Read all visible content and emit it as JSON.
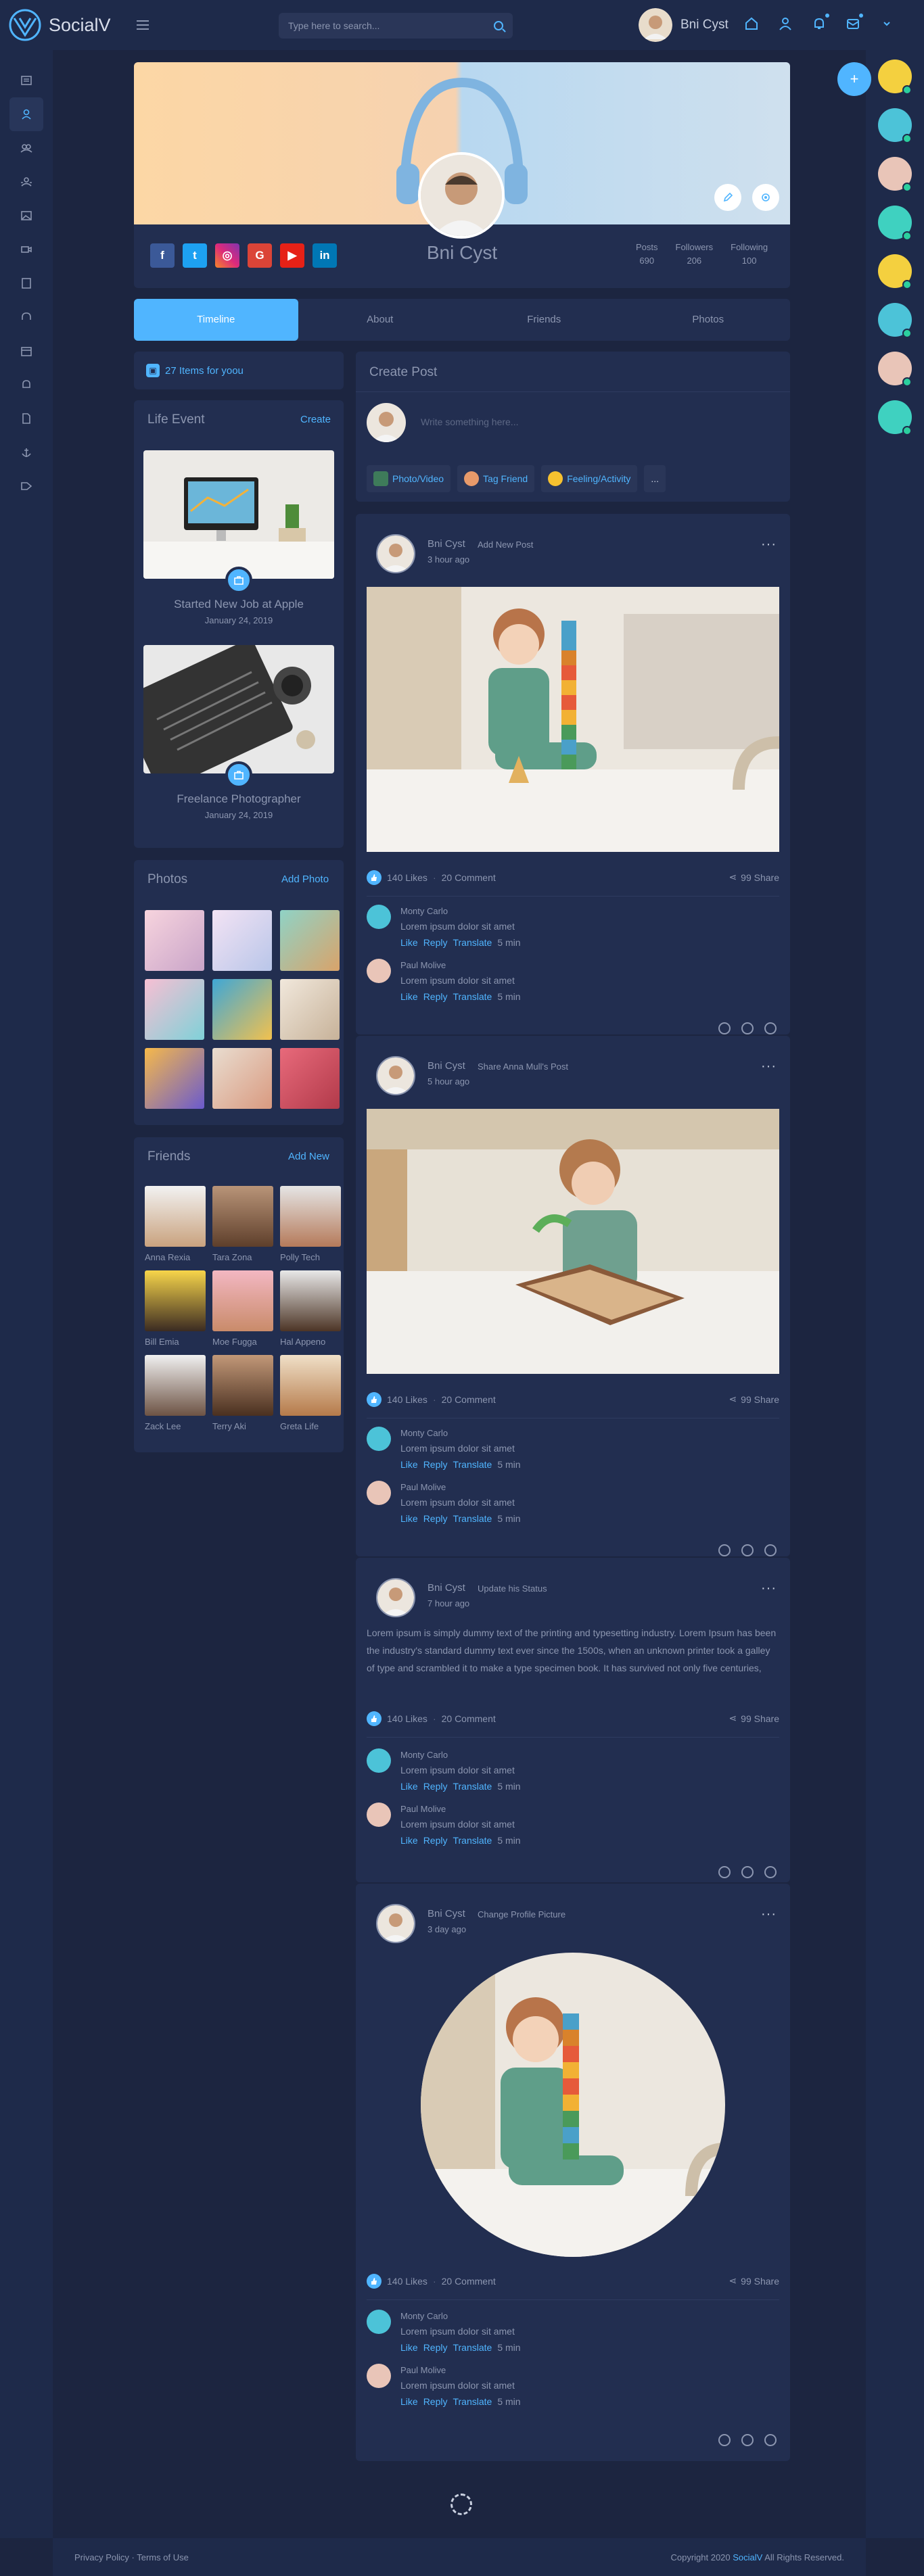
{
  "app": {
    "name": "SocialV"
  },
  "search": {
    "placeholder": "Type here to search..."
  },
  "topbar": {
    "user_name": "Bni Cyst"
  },
  "profile": {
    "name": "Bni Cyst",
    "stats": [
      {
        "label": "Posts",
        "value": "690"
      },
      {
        "label": "Followers",
        "value": "206"
      },
      {
        "label": "Following",
        "value": "100"
      }
    ],
    "social": [
      "facebook",
      "twitter",
      "instagram",
      "google-plus",
      "youtube",
      "linkedin"
    ]
  },
  "tabs": [
    "Timeline",
    "About",
    "Friends",
    "Photos"
  ],
  "items_for_you": "27 Items for yoou",
  "life_event": {
    "title": "Life Event",
    "action": "Create",
    "events": [
      {
        "title": "Started New Job at Apple",
        "date": "January 24, 2019"
      },
      {
        "title": "Freelance Photographer",
        "date": "January 24, 2019"
      }
    ]
  },
  "photos": {
    "title": "Photos",
    "action": "Add Photo"
  },
  "friends": {
    "title": "Friends",
    "action": "Add New",
    "list": [
      "Anna Rexia",
      "Tara Zona",
      "Polly Tech",
      "Bill Emia",
      "Moe Fugga",
      "Hal Appeno",
      "Zack Lee",
      "Terry Aki",
      "Greta Life"
    ]
  },
  "create_post": {
    "title": "Create Post",
    "placeholder": "Write something here...",
    "actions": [
      "Photo/Video",
      "Tag Friend",
      "Feeling/Activity",
      "..."
    ]
  },
  "posts": [
    {
      "author": "Bni Cyst",
      "action": "Add New Post",
      "time": "3 hour ago",
      "likes": "140 Likes",
      "comments": "20 Comment",
      "shares": "99 Share"
    },
    {
      "author": "Bni Cyst",
      "action": "Share Anna Mull's Post",
      "time": "5 hour ago",
      "likes": "140 Likes",
      "comments": "20 Comment",
      "shares": "99 Share"
    },
    {
      "author": "Bni Cyst",
      "action": "Update his Status",
      "time": "7 hour ago",
      "text": "Lorem ipsum is simply dummy text of the printing and typesetting industry. Lorem Ipsum has been the industry's standard dummy text ever since the 1500s, when an unknown printer took a galley of type and scrambled it to make a type specimen book. It has survived not only five centuries,",
      "likes": "140 Likes",
      "comments": "20 Comment",
      "shares": "99 Share"
    },
    {
      "author": "Bni Cyst",
      "action": "Change Profile Picture",
      "time": "3 day ago",
      "likes": "140 Likes",
      "comments": "20 Comment",
      "shares": "99 Share"
    }
  ],
  "comments": [
    {
      "name": "Monty Carlo",
      "text": "Lorem ipsum dolor sit amet"
    },
    {
      "name": "Paul Molive",
      "text": "Lorem ipsum dolor sit amet"
    }
  ],
  "comment_links": {
    "like": "Like",
    "reply": "Reply",
    "translate": "Translate",
    "time": "5 min"
  },
  "footer": {
    "privacy": "Privacy Policy",
    "sep": " · ",
    "terms": "Terms of Use",
    "copyright_pre": "Copyright 2020 ",
    "brand": "SocialV",
    "copyright_post": " All Rights Reserved."
  },
  "colors": {
    "accent": "#50b5ff",
    "bg": "#1c2540",
    "card": "#222e50",
    "online": "#2bcf9e"
  }
}
